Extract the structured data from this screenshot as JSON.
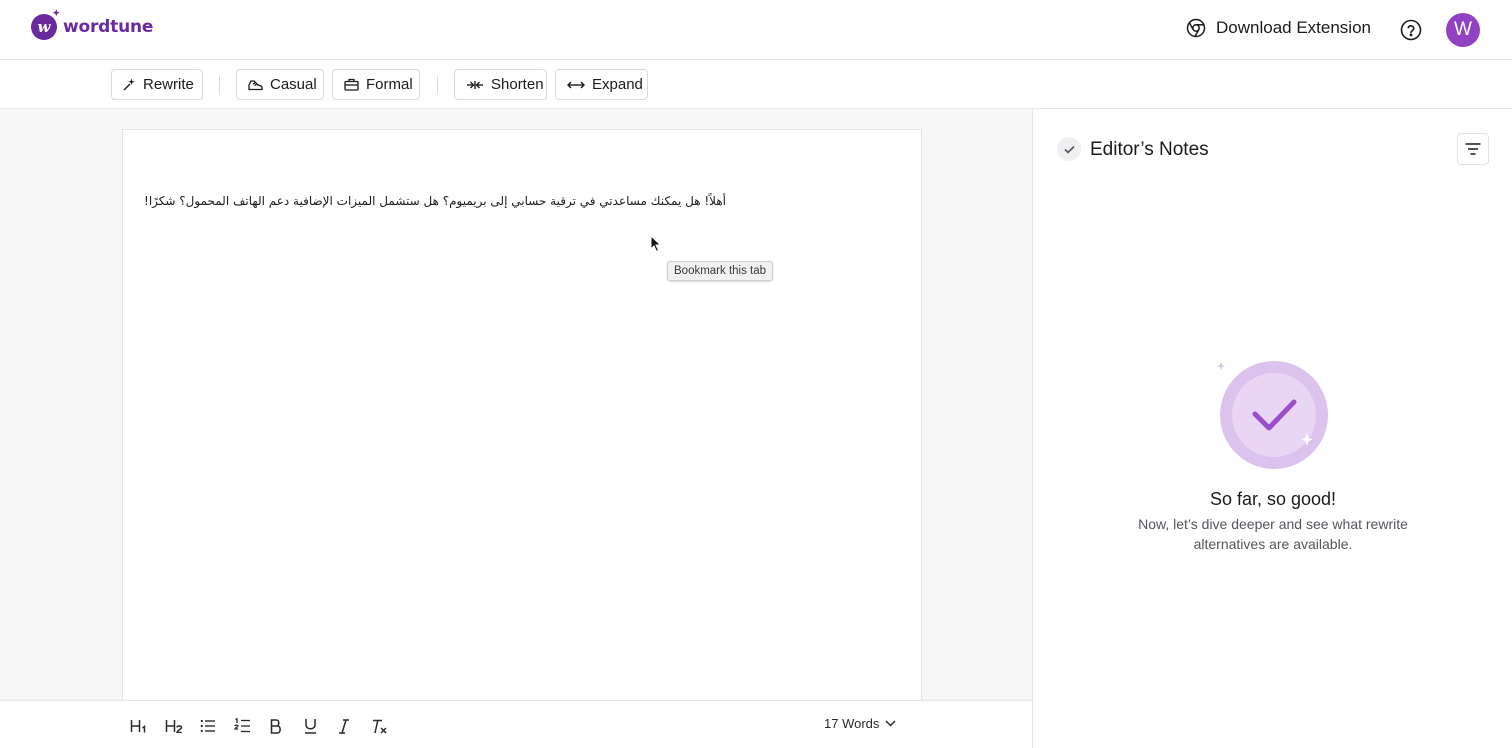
{
  "header": {
    "logo_text": "wordtune",
    "logo_mark_icon": "wordtune-logo-icon",
    "download_extension_label": "Download Extension",
    "avatar_initial": "W"
  },
  "toolbar": {
    "rewrite_label": "Rewrite",
    "casual_label": "Casual",
    "formal_label": "Formal",
    "shorten_label": "Shorten",
    "expand_label": "Expand"
  },
  "editor": {
    "text": "أهلاً! هل يمكنك مساعدتي في ترقية حسابي إلى بريميوم؟ هل ستشمل الميزات الإضافية دعم الهاتف المحمول؟ شكرًا!",
    "tooltip": "Bookmark this tab"
  },
  "bottom_bar": {
    "h1_label": "H1",
    "h2_label": "H2",
    "word_count": "17 Words"
  },
  "notes": {
    "title": "Editor’s Notes",
    "empty_title": "So far, so good!",
    "empty_subtitle": "Now, let’s dive deeper and see what rewrite alternatives are available."
  },
  "colors": {
    "brand": "#6a2a9b",
    "avatar": "#9141c1",
    "illustration_outer": "#dcc3ee",
    "illustration_check": "#9b4fc7"
  }
}
